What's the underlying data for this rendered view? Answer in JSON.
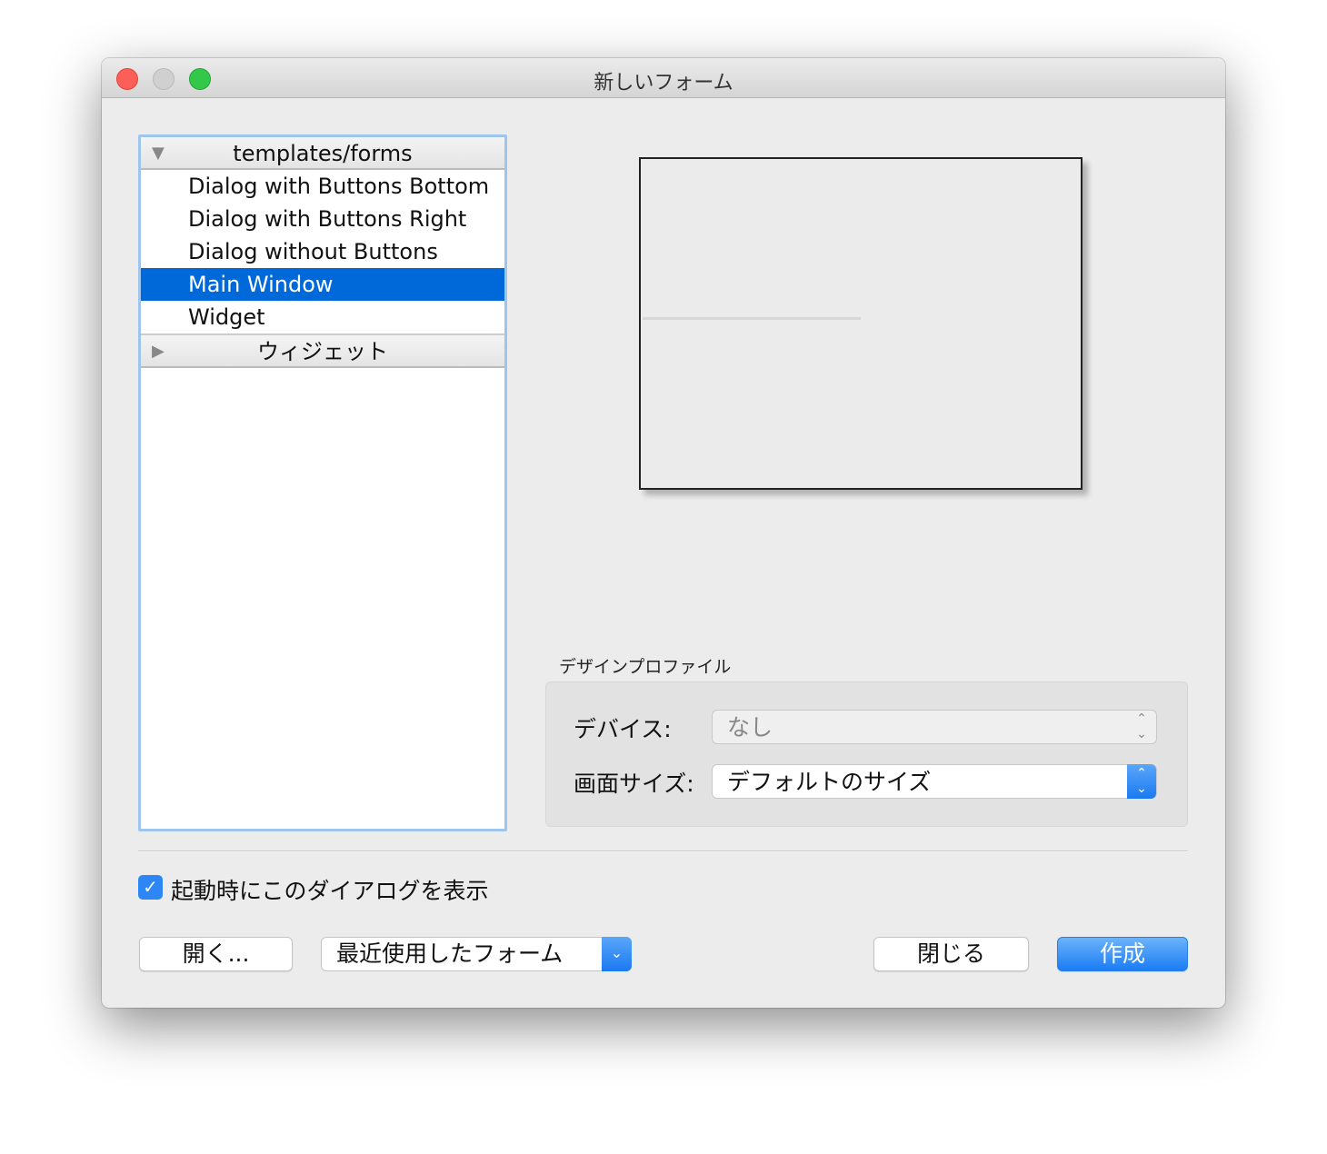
{
  "window": {
    "title": "新しいフォーム"
  },
  "tree": {
    "groups": [
      {
        "label": "templates/forms",
        "expanded": true
      },
      {
        "label": "ウィジェット",
        "expanded": false
      }
    ],
    "items": [
      "Dialog with Buttons Bottom",
      "Dialog with Buttons Right",
      "Dialog without Buttons",
      "Main Window",
      "Widget"
    ],
    "selected": "Main Window"
  },
  "profile": {
    "title": "デザインプロファイル",
    "device_label": "デバイス:",
    "device_value": "なし",
    "screen_label": "画面サイズ:",
    "screen_value": "デフォルトのサイズ"
  },
  "show_on_startup": {
    "label": "起動時にこのダイアログを表示",
    "checked": true
  },
  "buttons": {
    "open": "開く...",
    "recent": "最近使用したフォーム",
    "close": "閉じる",
    "create": "作成"
  },
  "colors": {
    "accent": "#0069d9",
    "primary_button": "#1a7cf5"
  }
}
